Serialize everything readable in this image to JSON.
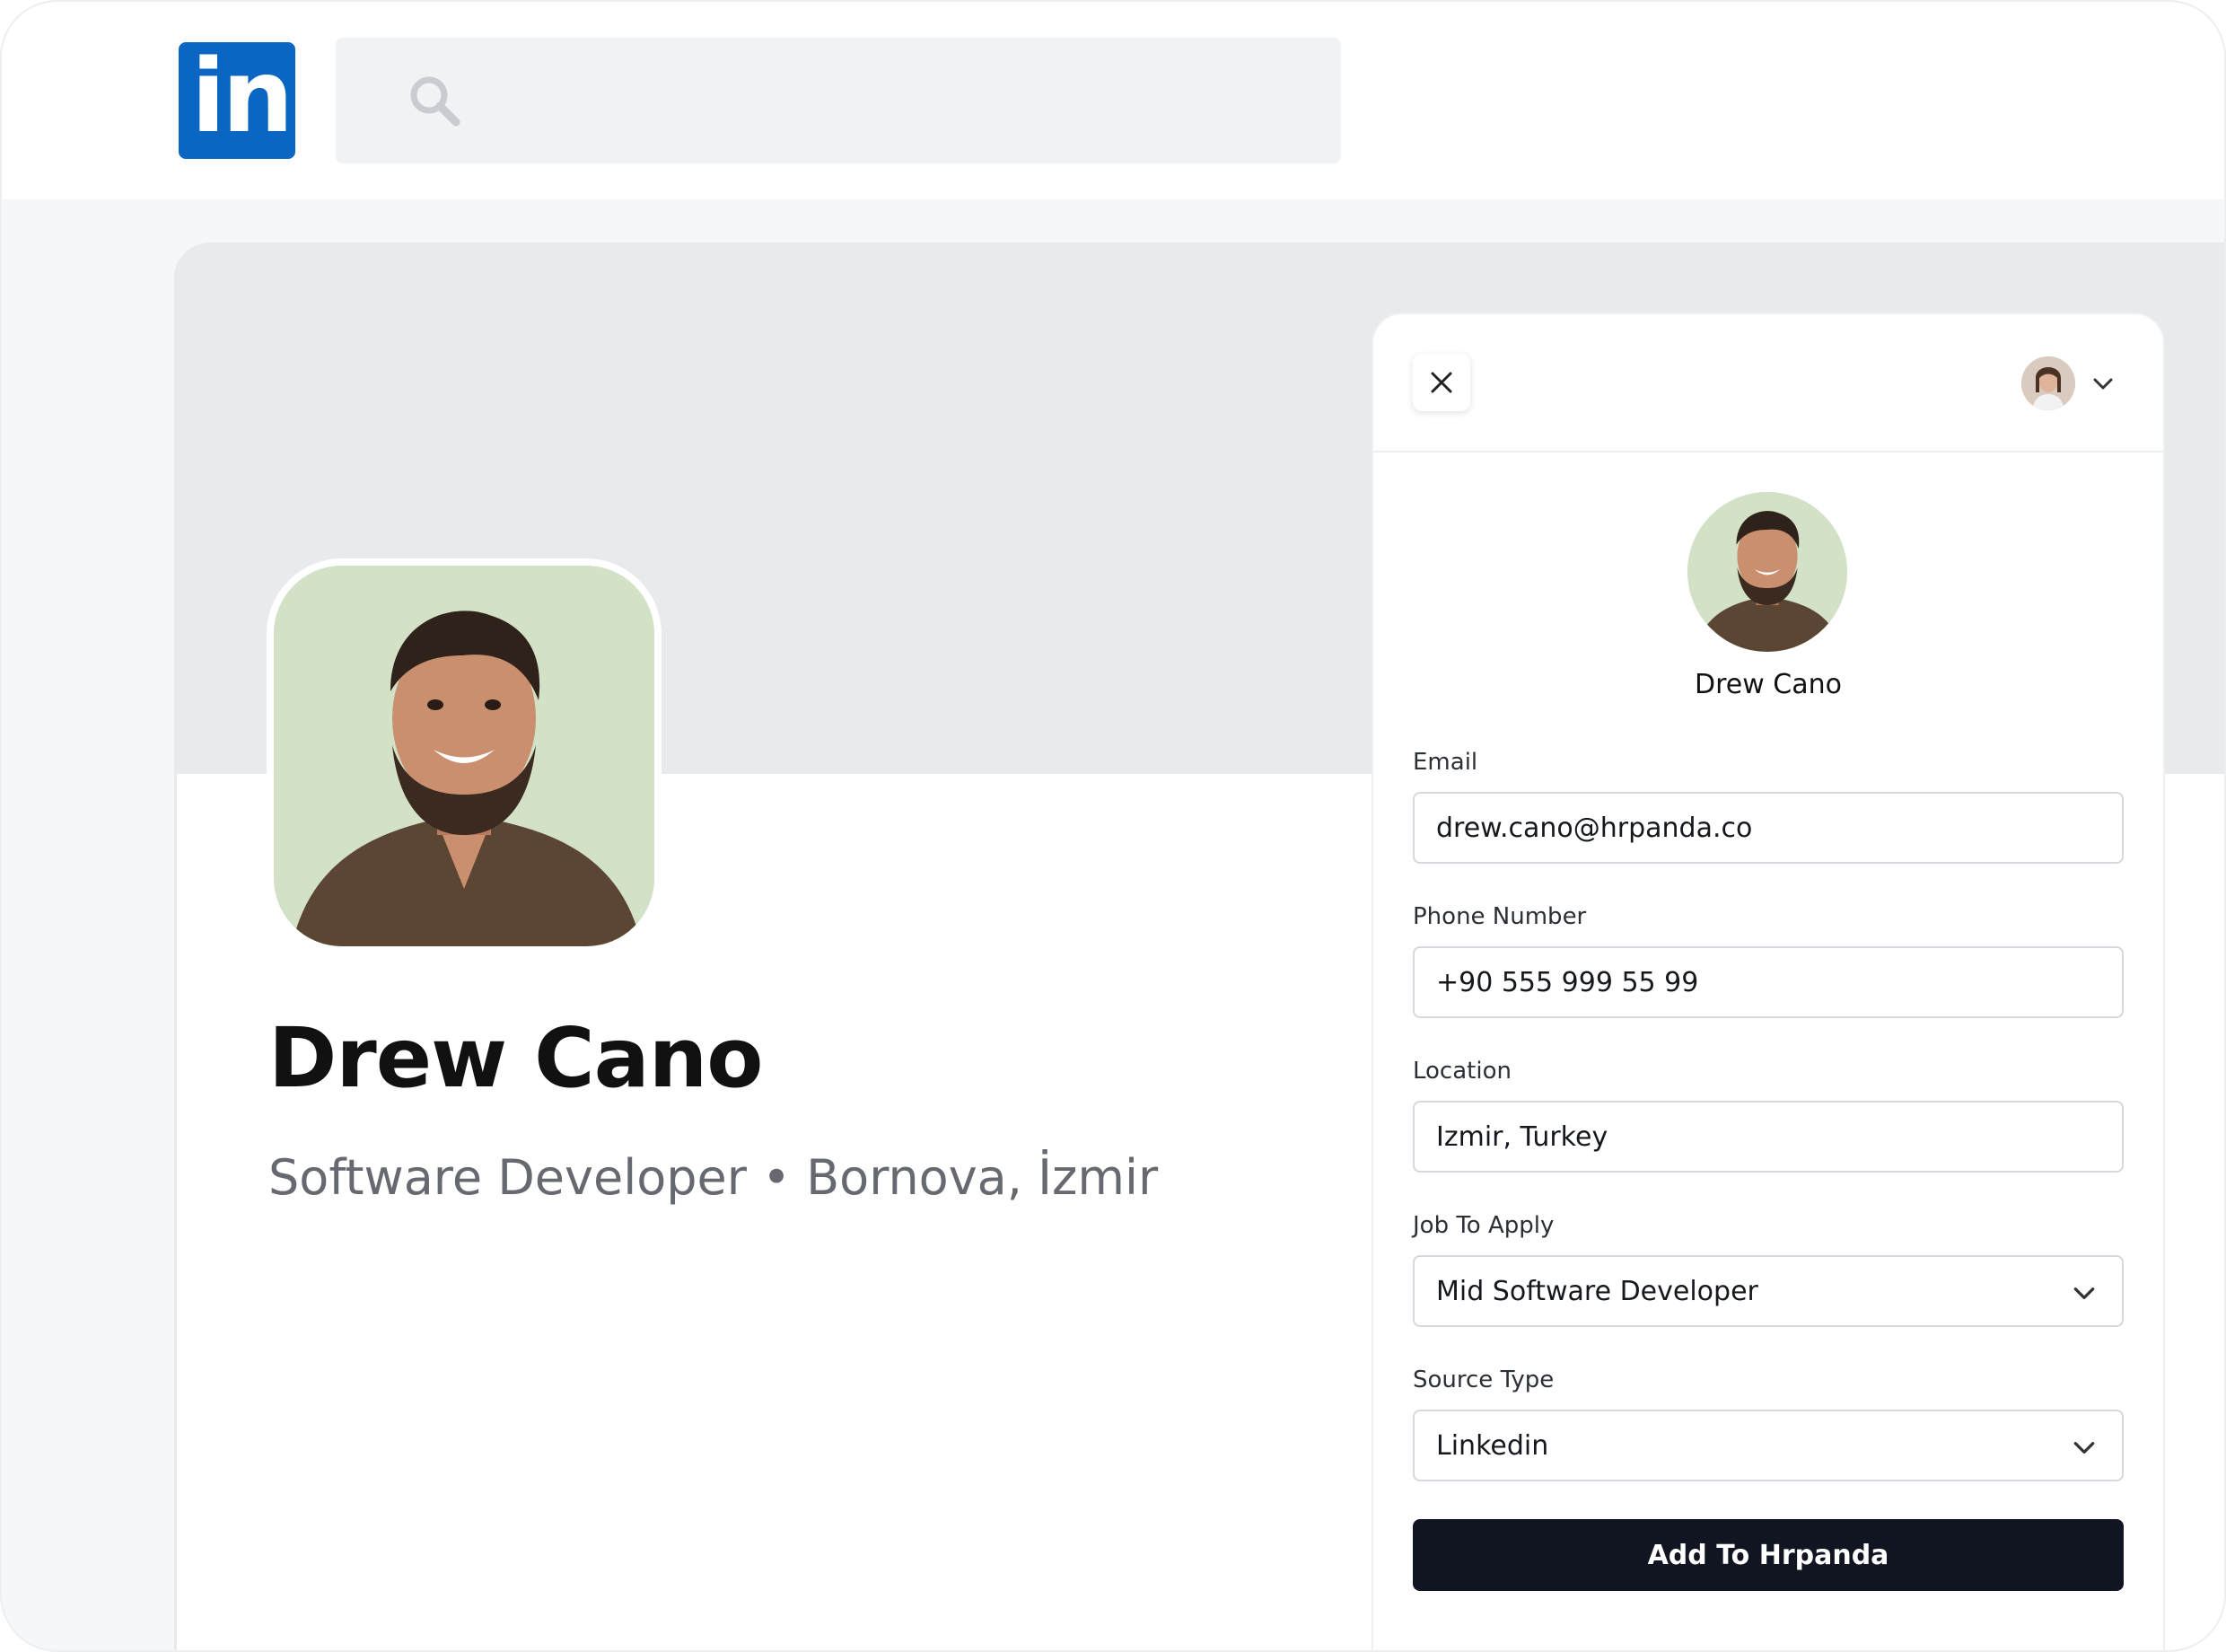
{
  "brand": {
    "logo_text": "in",
    "color": "#0a66c2"
  },
  "search": {
    "icon": "search-icon"
  },
  "profile": {
    "name": "Drew Cano",
    "subtitle": "Software Developer • Bornova, İzmir"
  },
  "panel": {
    "close_icon": "close-icon",
    "menu_icon": "chevron-down-icon",
    "candidate_name": "Drew Cano",
    "fields": {
      "email": {
        "label": "Email",
        "value": "drew.cano@hrpanda.co"
      },
      "phone": {
        "label": "Phone Number",
        "value": "+90 555 999 55 99"
      },
      "location": {
        "label": "Location",
        "value": "Izmir, Turkey"
      },
      "job": {
        "label": "Job To Apply",
        "value": "Mid Software Developer"
      },
      "source": {
        "label": "Source Type",
        "value": "Linkedin"
      }
    },
    "submit_label": "Add To Hrpanda"
  }
}
